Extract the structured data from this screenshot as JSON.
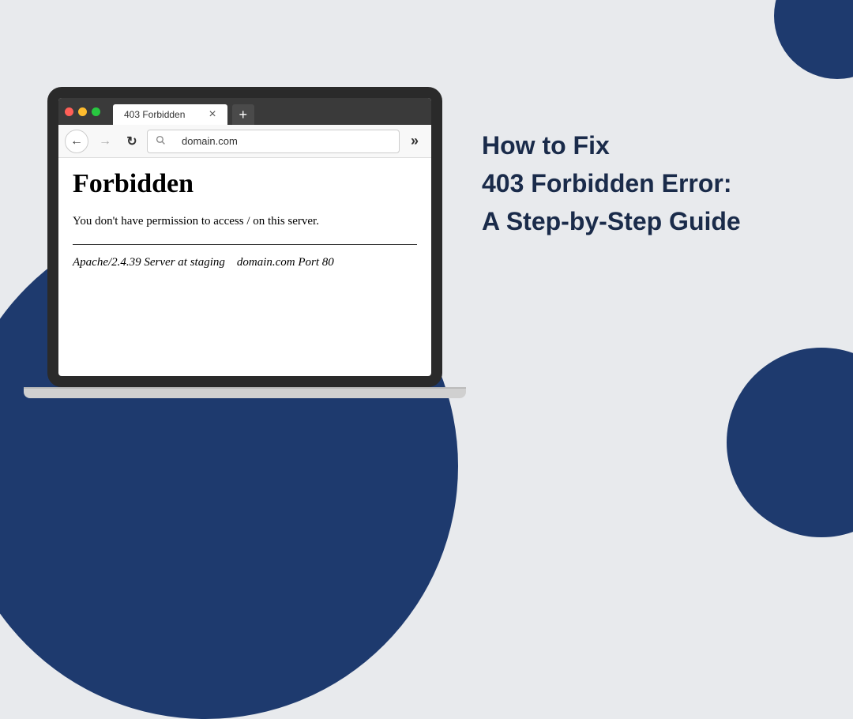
{
  "decorations": {
    "color": "#1e3a6e"
  },
  "browser": {
    "tab_title": "403 Forbidden",
    "url": "domain.com",
    "page": {
      "heading": "Forbidden",
      "message": "You don't have permission to access / on this server.",
      "server_line": "Apache/2.4.39 Server at staging domain.com Port 80"
    }
  },
  "headline": {
    "line1": "How to Fix",
    "line2": "403 Forbidden Error:",
    "line3": "A Step-by-Step Guide"
  }
}
